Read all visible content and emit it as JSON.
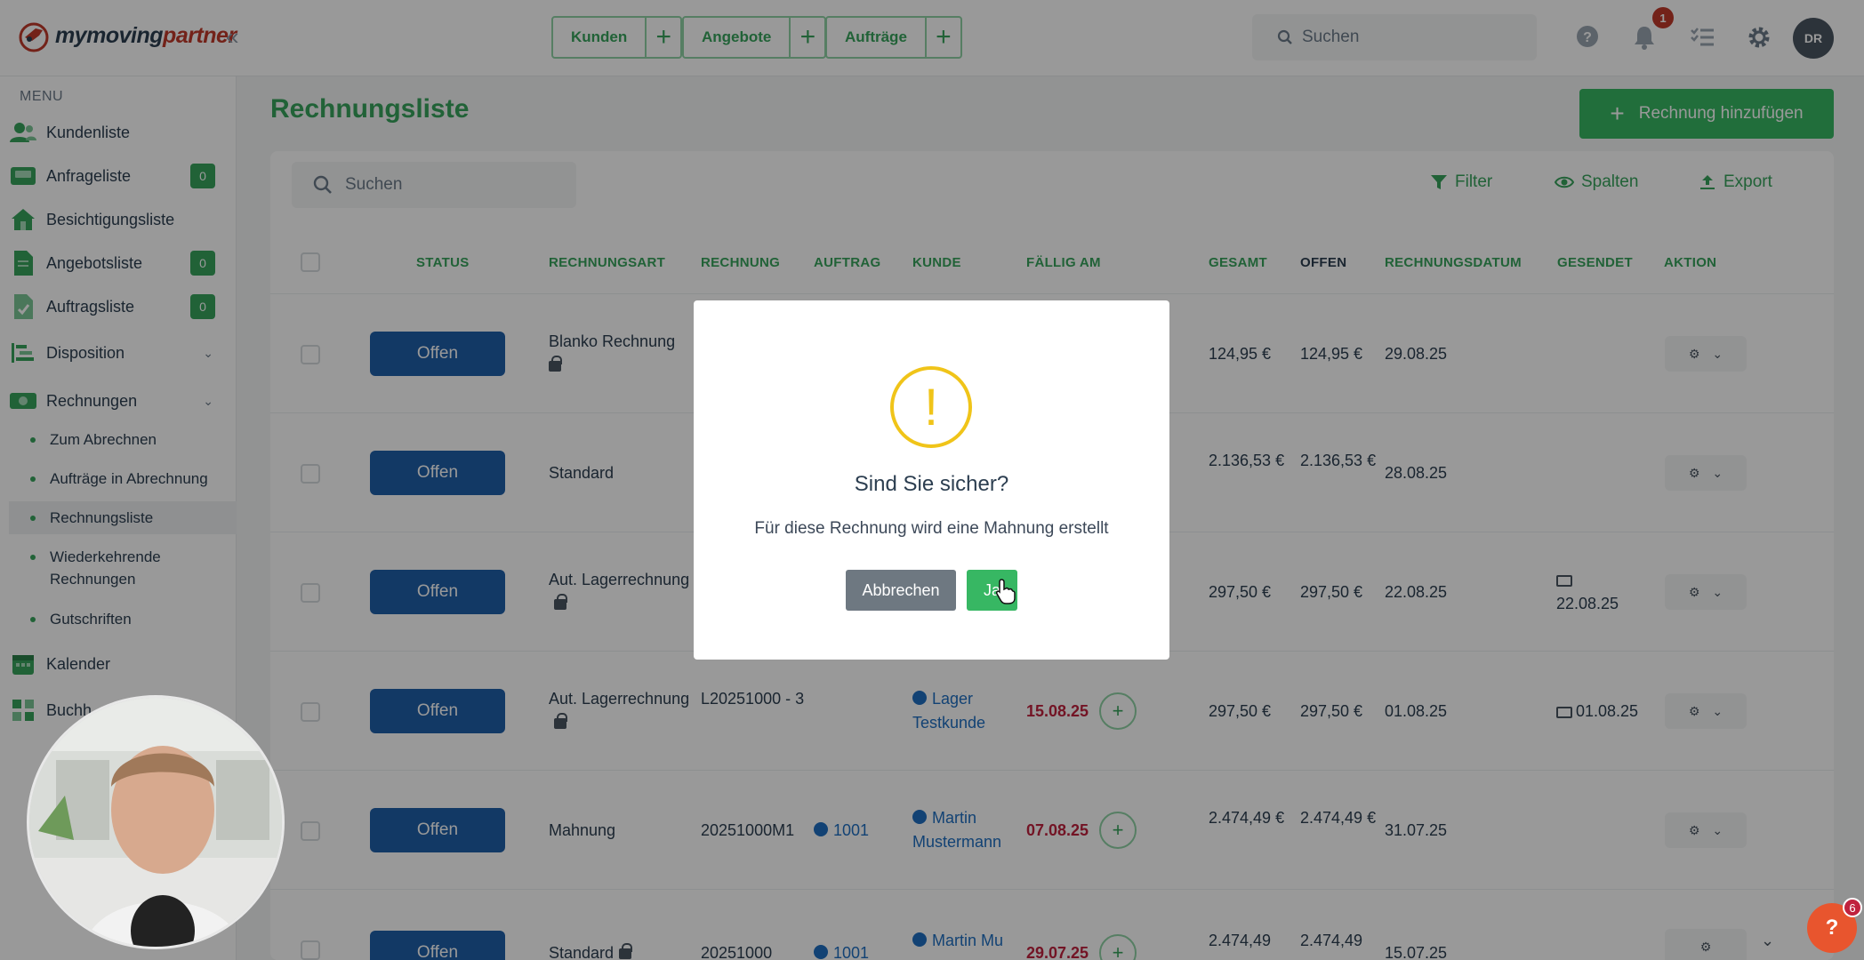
{
  "brand": {
    "logo_text_a": "my",
    "logo_text_b": "moving",
    "logo_text_c": "partner"
  },
  "quick_nav": [
    {
      "label": "Kunden"
    },
    {
      "label": "Angebote"
    },
    {
      "label": "Aufträge"
    }
  ],
  "top_search": {
    "placeholder": "Suchen"
  },
  "notifications": {
    "count": "1"
  },
  "user": {
    "initials": "DR"
  },
  "sidebar": {
    "menu_title": "MENU",
    "items": [
      {
        "label": "Kundenliste"
      },
      {
        "label": "Anfrageliste",
        "count": "0"
      },
      {
        "label": "Besichtigungsliste"
      },
      {
        "label": "Angebotsliste",
        "count": "0"
      },
      {
        "label": "Auftragsliste",
        "count": "0"
      },
      {
        "label": "Disposition"
      },
      {
        "label": "Rechnungen"
      },
      {
        "label": "Kalender"
      },
      {
        "label": "Buchh"
      }
    ],
    "sub_items": [
      {
        "label": "Zum Abrechnen"
      },
      {
        "label": "Aufträge in Abrechnung"
      },
      {
        "label": "Rechnungsliste"
      },
      {
        "label": "Wiederkehrende Rechnungen"
      },
      {
        "label": "Gutschriften"
      }
    ]
  },
  "page": {
    "title": "Rechnungsliste",
    "add_button": "Rechnung hinzufügen",
    "search_placeholder": "Suchen",
    "tools": {
      "filter": "Filter",
      "columns": "Spalten",
      "export": "Export"
    }
  },
  "table": {
    "headers": {
      "status": "STATUS",
      "type": "RECHNUNGSART",
      "invoice": "RECHNUNG",
      "order": "AUFTRAG",
      "customer": "KUNDE",
      "due": "FÄLLIG AM",
      "total": "GESAMT",
      "open": "OFFEN",
      "date": "RECHNUNGSDATUM",
      "sent": "GESENDET",
      "action": "AKTION"
    },
    "rows": [
      {
        "status": "Offen",
        "type": "Blanko Rechnung",
        "invoice": "",
        "order": "",
        "customer": "",
        "due": "",
        "total": "124,95 €",
        "open": "124,95 €",
        "date": "29.08.25",
        "sent": ""
      },
      {
        "status": "Offen",
        "type": "Standard",
        "invoice": "",
        "order": "",
        "customer": "",
        "due": "",
        "total": "2.136,53 €",
        "open": "2.136,53 €",
        "date": "28.08.25",
        "sent": ""
      },
      {
        "status": "Offen",
        "type": "Aut. Lagerrechnung",
        "invoice": "",
        "order": "",
        "customer": "",
        "due": "",
        "total": "297,50 €",
        "open": "297,50 €",
        "date": "22.08.25",
        "sent": "22.08.25"
      },
      {
        "status": "Offen",
        "type": "Aut. Lagerrechnung",
        "invoice": "L20251000 - 3",
        "order": "",
        "customer": "Lager Testkunde",
        "due": "15.08.25",
        "total": "297,50 €",
        "open": "297,50 €",
        "date": "01.08.25",
        "sent": "01.08.25"
      },
      {
        "status": "Offen",
        "type": "Mahnung",
        "invoice": "20251000M1",
        "order": "1001",
        "customer": "Martin Mustermann",
        "due": "07.08.25",
        "total": "2.474,49 €",
        "open": "2.474,49 €",
        "date": "31.07.25",
        "sent": ""
      },
      {
        "status": "Offen",
        "type": "Standard",
        "invoice": "20251000",
        "order": "1001",
        "customer": "Martin Mu",
        "due": "29.07.25",
        "total": "2.474,49",
        "open": "2.474,49",
        "date": "15.07.25",
        "sent": ""
      }
    ]
  },
  "dialog": {
    "icon": "!",
    "title": "Sind Sie sicher?",
    "text": "Für diese Rechnung wird eine Mahnung erstellt",
    "cancel": "Abbrechen",
    "confirm": "Ja"
  },
  "help": {
    "label": "?",
    "badge": "6"
  },
  "colors": {
    "accent": "#37a35d",
    "status_blue": "#1f5fa8",
    "warning": "#f0c419",
    "danger": "#c0223e"
  }
}
